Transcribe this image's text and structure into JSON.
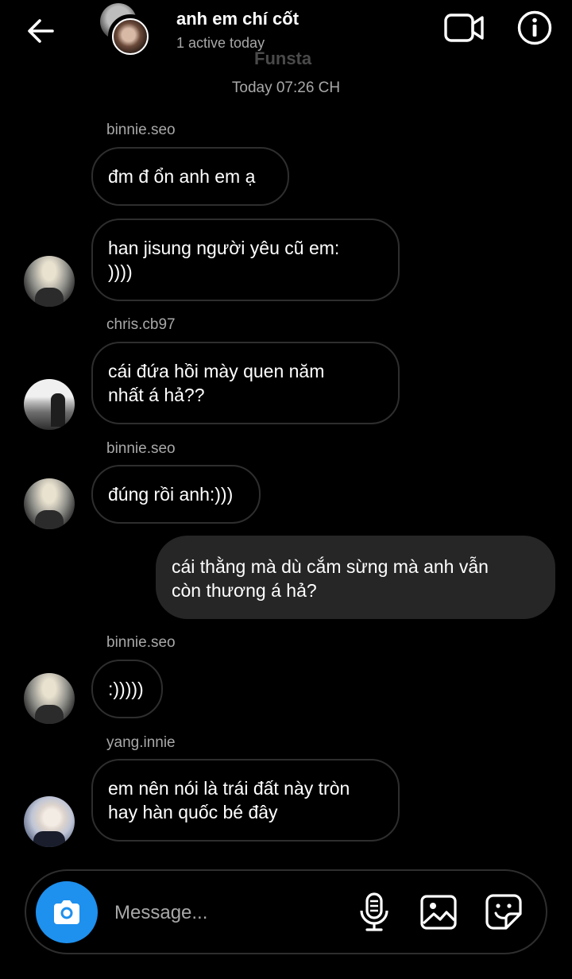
{
  "header": {
    "title": "anh em chí cốt",
    "status": "1 active today",
    "account_label": "Funsta"
  },
  "timestamp": "Today 07:26 CH",
  "messages": [
    {
      "sender": "binnie.seo",
      "text": "đm đ ổn anh em ạ"
    },
    {
      "sender": "",
      "text": "han jisung người yêu cũ em:\n))))"
    },
    {
      "sender": "chris.cb97",
      "text": "cái đứa hồi mày quen năm\nnhất á hả??"
    },
    {
      "sender": "binnie.seo",
      "text": "đúng rồi anh:)))"
    },
    {
      "sender": "me",
      "text": "cái thằng mà dù cắm sừng mà anh vẫn\ncòn thương á hả?"
    },
    {
      "sender": "binnie.seo",
      "text": ":)))))"
    },
    {
      "sender": "yang.innie",
      "text": "em nên nói là trái đất này tròn\nhay hàn quốc bé đây"
    }
  ],
  "composer": {
    "placeholder": "Message..."
  },
  "icons": [
    "back-arrow-icon",
    "video-call-icon",
    "info-icon",
    "camera-icon",
    "microphone-icon",
    "gallery-icon",
    "sticker-icon"
  ],
  "colors": {
    "background": "#000000",
    "accent": "#1e90ee",
    "own_bubble": "#262626",
    "muted_text": "#a8a8a8"
  }
}
